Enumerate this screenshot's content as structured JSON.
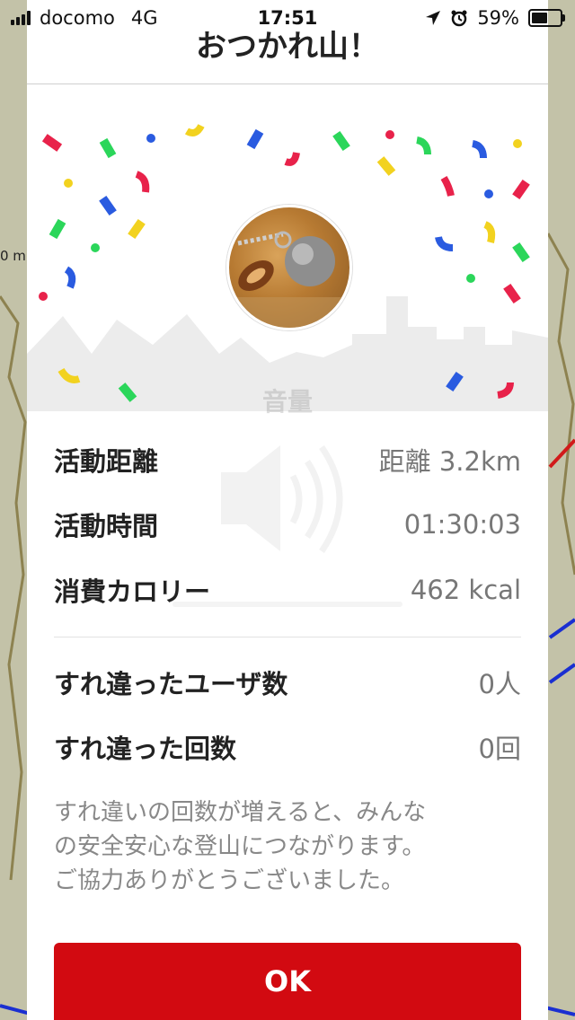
{
  "status_bar": {
    "carrier": "docomo",
    "network": "4G",
    "time": "17:51",
    "battery": "59%",
    "battery_level": 0.59
  },
  "dialog": {
    "title": "おつかれ山！",
    "stats": [
      {
        "label": "活動距離",
        "value": "距離 3.2km"
      },
      {
        "label": "活動時間",
        "value": "01:30:03"
      },
      {
        "label": "消費カロリー",
        "value": "462 kcal"
      }
    ],
    "passes": [
      {
        "label": "すれ違ったユーザ数",
        "value": "0人"
      },
      {
        "label": "すれ違った回数",
        "value": "0回"
      }
    ],
    "note_lines": [
      "すれ違いの回数が増えると、みんな",
      "の安全安心な登山につながります。",
      "ご協力ありがとうございました。"
    ],
    "ok_label": "OK"
  },
  "overlay": {
    "volume_label": "音量"
  },
  "map": {
    "scale_label": "0 m"
  },
  "colors": {
    "accent": "#d20a11",
    "confetti": [
      "#e8224a",
      "#2bd65a",
      "#2a5be0",
      "#f2d21f"
    ]
  }
}
